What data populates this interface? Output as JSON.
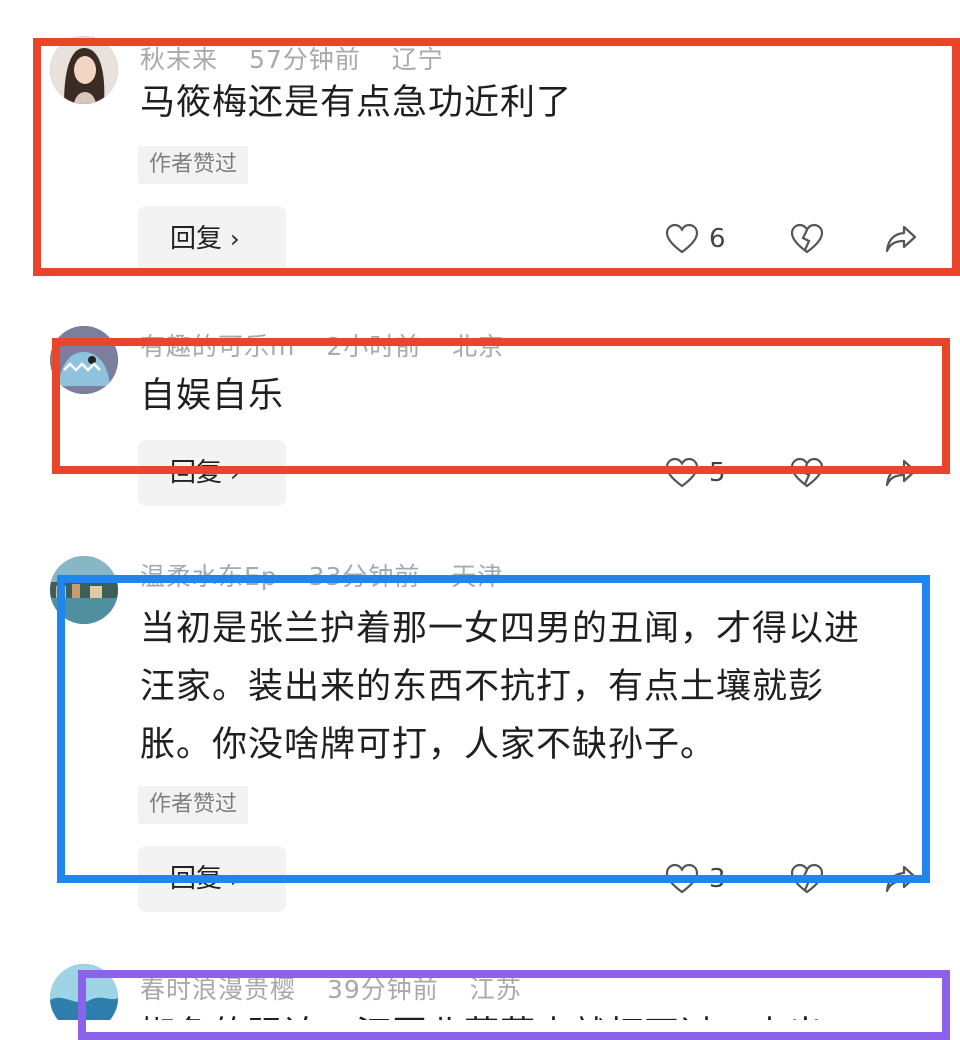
{
  "comments": [
    {
      "username": "秋末来",
      "time": "57分钟前",
      "location": "辽宁",
      "text": "马筱梅还是有点急功近利了",
      "badge": "作者赞过",
      "reply_label": "回复",
      "likes": "6",
      "avatar_color": "#5a4d44"
    },
    {
      "username": "有趣的可乐m",
      "time": "2小时前",
      "location": "北京",
      "text": "自娱自乐",
      "reply_label": "回复",
      "likes": "5",
      "avatar_color": "#6e7896"
    },
    {
      "username": "温柔水东Ep",
      "time": "33分钟前",
      "location": "天津",
      "text": "当初是张兰护着那一女四男的丑闻，才得以进汪家。装出来的东西不抗打，有点土壤就彭胀。你没啥牌可打，人家不缺孙子。",
      "badge": "作者赞过",
      "reply_label": "回复",
      "likes": "3",
      "avatar_color": "#4f7e79"
    },
    {
      "username": "春时浪漫贵樱",
      "time": "39分钟前",
      "location": "江苏",
      "text": "椒色的强迫，汪圈北菲菲来就打不过，来出",
      "avatar_color": "#3f8fb8"
    }
  ],
  "colors": {
    "red_frame": "#e8452a",
    "blue_frame": "#1f86f0",
    "purple_frame": "#8b63ea"
  },
  "icons": [
    "like-heart-icon",
    "dislike-broken-heart-icon",
    "share-arrow-icon",
    "chevron-right-icon"
  ]
}
